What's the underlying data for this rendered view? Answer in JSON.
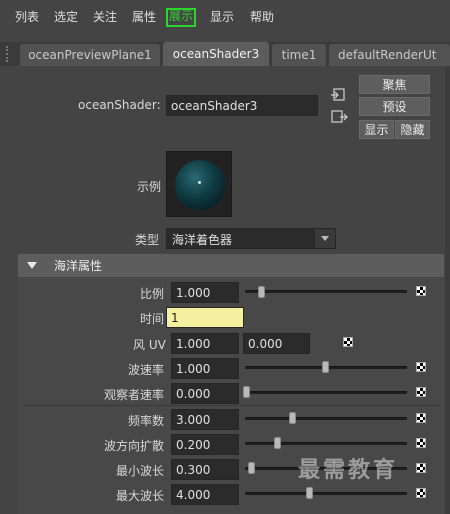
{
  "menubar": {
    "items": [
      {
        "label": "列表"
      },
      {
        "label": "选定"
      },
      {
        "label": "关注"
      },
      {
        "label": "属性"
      },
      {
        "label": "展示"
      },
      {
        "label": "显示"
      },
      {
        "label": "帮助"
      }
    ],
    "highlight_color": "#2bd52b"
  },
  "tabs": [
    {
      "label": "oceanPreviewPlane1",
      "active": false
    },
    {
      "label": "oceanShader3",
      "active": true
    },
    {
      "label": "time1",
      "active": false
    },
    {
      "label": "defaultRenderUt",
      "active": false
    }
  ],
  "header": {
    "node_label": "oceanShader:",
    "node_value": "oceanShader3",
    "focus_button": "聚焦",
    "presets_button": "预设",
    "show_button": "显示",
    "hide_button": "隐藏"
  },
  "sample": {
    "label": "示例"
  },
  "type": {
    "label": "类型",
    "value": "海洋着色器"
  },
  "section": {
    "title": "海洋属性"
  },
  "attributes": [
    {
      "label": "比例",
      "value": "1.000",
      "slider": 0.12
    },
    {
      "label": "时间",
      "value": "1",
      "highlighted": true
    },
    {
      "label": "风 UV",
      "value": "1.000",
      "value2": "0.000"
    },
    {
      "label": "波速率",
      "value": "1.000",
      "slider": 0.5
    },
    {
      "label": "观察者速率",
      "value": "0.000",
      "slider": 0.0
    },
    {
      "label": "频率数",
      "value": "3.000",
      "slider": 0.3
    },
    {
      "label": "波方向扩散",
      "value": "0.200",
      "slider": 0.2
    },
    {
      "label": "最小波长",
      "value": "0.300",
      "slider": 0.03
    },
    {
      "label": "最大波长",
      "value": "4.000",
      "slider": 0.4
    }
  ],
  "watermark": "最需教育"
}
